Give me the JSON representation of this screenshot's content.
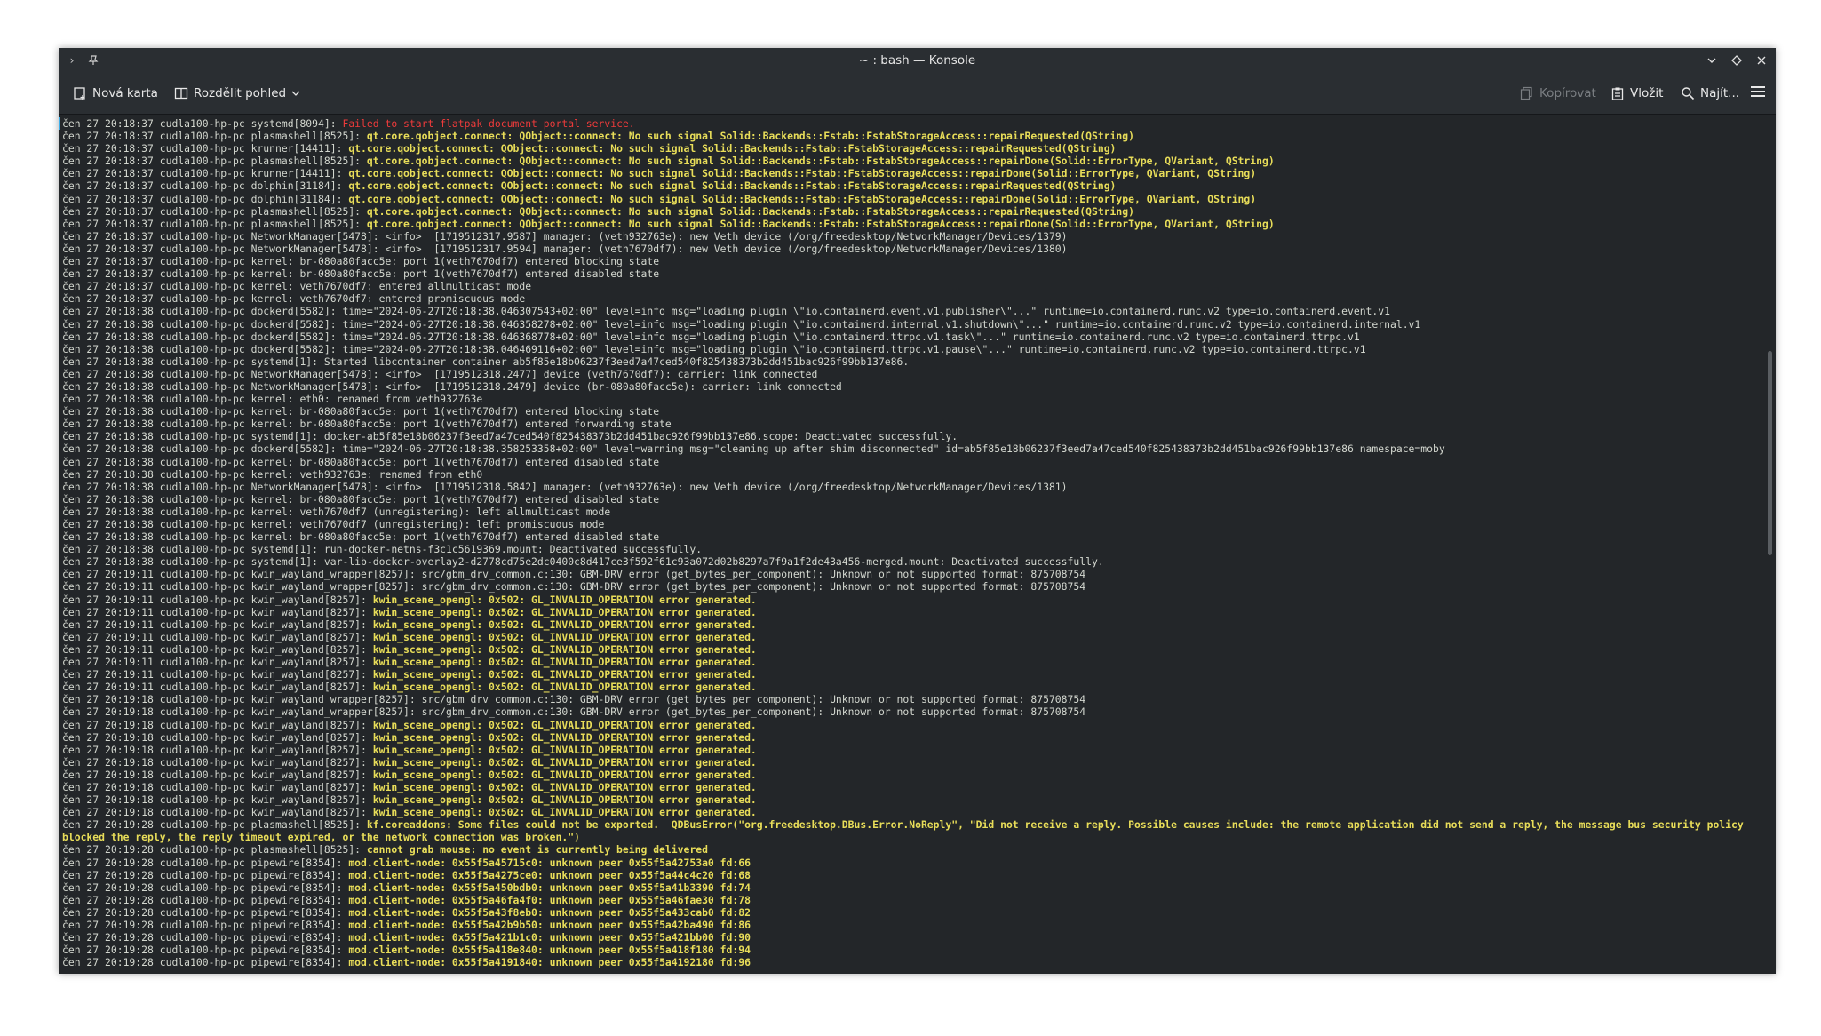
{
  "window": {
    "title": "~ : bash — Konsole"
  },
  "toolbar": {
    "new_tab": "Nová karta",
    "split_view": "Rozdělit pohled",
    "copy": "Kopírovat",
    "paste": "Vložit",
    "find": "Najít..."
  },
  "icons": {
    "expand": "chevron-right-icon",
    "pin": "pin-icon",
    "minimize": "chevron-down-icon",
    "maximize": "diamond-icon",
    "close": "close-icon",
    "new_tab": "new-tab-icon",
    "split": "split-view-icon",
    "copy": "copy-icon",
    "paste": "paste-icon",
    "search": "search-icon",
    "menu": "hamburger-menu-icon"
  },
  "colors": {
    "warning": "#e8dd59",
    "error": "#ef3b3b",
    "normal": "#d3d7cf",
    "background": "#232629"
  },
  "log_lines": [
    {
      "p": "čen 27 20:18:37 cudla100-hp-pc systemd[8094]: ",
      "m": "Failed to start flatpak document portal service.",
      "t": "err"
    },
    {
      "p": "čen 27 20:18:37 cudla100-hp-pc plasmashell[8525]: ",
      "m": "qt.core.qobject.connect: QObject::connect: No such signal Solid::Backends::Fstab::FstabStorageAccess::repairRequested(QString)",
      "t": "warn"
    },
    {
      "p": "čen 27 20:18:37 cudla100-hp-pc krunner[14411]: ",
      "m": "qt.core.qobject.connect: QObject::connect: No such signal Solid::Backends::Fstab::FstabStorageAccess::repairRequested(QString)",
      "t": "warn"
    },
    {
      "p": "čen 27 20:18:37 cudla100-hp-pc plasmashell[8525]: ",
      "m": "qt.core.qobject.connect: QObject::connect: No such signal Solid::Backends::Fstab::FstabStorageAccess::repairDone(Solid::ErrorType, QVariant, QString)",
      "t": "warn"
    },
    {
      "p": "čen 27 20:18:37 cudla100-hp-pc krunner[14411]: ",
      "m": "qt.core.qobject.connect: QObject::connect: No such signal Solid::Backends::Fstab::FstabStorageAccess::repairDone(Solid::ErrorType, QVariant, QString)",
      "t": "warn"
    },
    {
      "p": "čen 27 20:18:37 cudla100-hp-pc dolphin[31184]: ",
      "m": "qt.core.qobject.connect: QObject::connect: No such signal Solid::Backends::Fstab::FstabStorageAccess::repairRequested(QString)",
      "t": "warn"
    },
    {
      "p": "čen 27 20:18:37 cudla100-hp-pc dolphin[31184]: ",
      "m": "qt.core.qobject.connect: QObject::connect: No such signal Solid::Backends::Fstab::FstabStorageAccess::repairDone(Solid::ErrorType, QVariant, QString)",
      "t": "warn"
    },
    {
      "p": "čen 27 20:18:37 cudla100-hp-pc plasmashell[8525]: ",
      "m": "qt.core.qobject.connect: QObject::connect: No such signal Solid::Backends::Fstab::FstabStorageAccess::repairRequested(QString)",
      "t": "warn"
    },
    {
      "p": "čen 27 20:18:37 cudla100-hp-pc plasmashell[8525]: ",
      "m": "qt.core.qobject.connect: QObject::connect: No such signal Solid::Backends::Fstab::FstabStorageAccess::repairDone(Solid::ErrorType, QVariant, QString)",
      "t": "warn"
    },
    {
      "p": "čen 27 20:18:37 cudla100-hp-pc NetworkManager[5478]: <info>  [1719512317.9587] manager: (veth932763e): new Veth device (/org/freedesktop/NetworkManager/Devices/1379)",
      "m": "",
      "t": "n"
    },
    {
      "p": "čen 27 20:18:37 cudla100-hp-pc NetworkManager[5478]: <info>  [1719512317.9594] manager: (veth7670df7): new Veth device (/org/freedesktop/NetworkManager/Devices/1380)",
      "m": "",
      "t": "n"
    },
    {
      "p": "čen 27 20:18:37 cudla100-hp-pc kernel: br-080a80facc5e: port 1(veth7670df7) entered blocking state",
      "m": "",
      "t": "n"
    },
    {
      "p": "čen 27 20:18:37 cudla100-hp-pc kernel: br-080a80facc5e: port 1(veth7670df7) entered disabled state",
      "m": "",
      "t": "n"
    },
    {
      "p": "čen 27 20:18:37 cudla100-hp-pc kernel: veth7670df7: entered allmulticast mode",
      "m": "",
      "t": "n"
    },
    {
      "p": "čen 27 20:18:37 cudla100-hp-pc kernel: veth7670df7: entered promiscuous mode",
      "m": "",
      "t": "n"
    },
    {
      "p": "čen 27 20:18:38 cudla100-hp-pc dockerd[5582]: time=\"2024-06-27T20:18:38.046307543+02:00\" level=info msg=\"loading plugin \\\"io.containerd.event.v1.publisher\\\"...\" runtime=io.containerd.runc.v2 type=io.containerd.event.v1",
      "m": "",
      "t": "n"
    },
    {
      "p": "čen 27 20:18:38 cudla100-hp-pc dockerd[5582]: time=\"2024-06-27T20:18:38.046358278+02:00\" level=info msg=\"loading plugin \\\"io.containerd.internal.v1.shutdown\\\"...\" runtime=io.containerd.runc.v2 type=io.containerd.internal.v1",
      "m": "",
      "t": "n"
    },
    {
      "p": "čen 27 20:18:38 cudla100-hp-pc dockerd[5582]: time=\"2024-06-27T20:18:38.046368778+02:00\" level=info msg=\"loading plugin \\\"io.containerd.ttrpc.v1.task\\\"...\" runtime=io.containerd.runc.v2 type=io.containerd.ttrpc.v1",
      "m": "",
      "t": "n"
    },
    {
      "p": "čen 27 20:18:38 cudla100-hp-pc dockerd[5582]: time=\"2024-06-27T20:18:38.046469116+02:00\" level=info msg=\"loading plugin \\\"io.containerd.ttrpc.v1.pause\\\"...\" runtime=io.containerd.runc.v2 type=io.containerd.ttrpc.v1",
      "m": "",
      "t": "n"
    },
    {
      "p": "čen 27 20:18:38 cudla100-hp-pc systemd[1]: Started libcontainer container ab5f85e18b06237f3eed7a47ced540f825438373b2dd451bac926f99bb137e86.",
      "m": "",
      "t": "n"
    },
    {
      "p": "čen 27 20:18:38 cudla100-hp-pc NetworkManager[5478]: <info>  [1719512318.2477] device (veth7670df7): carrier: link connected",
      "m": "",
      "t": "n"
    },
    {
      "p": "čen 27 20:18:38 cudla100-hp-pc NetworkManager[5478]: <info>  [1719512318.2479] device (br-080a80facc5e): carrier: link connected",
      "m": "",
      "t": "n"
    },
    {
      "p": "čen 27 20:18:38 cudla100-hp-pc kernel: eth0: renamed from veth932763e",
      "m": "",
      "t": "n"
    },
    {
      "p": "čen 27 20:18:38 cudla100-hp-pc kernel: br-080a80facc5e: port 1(veth7670df7) entered blocking state",
      "m": "",
      "t": "n"
    },
    {
      "p": "čen 27 20:18:38 cudla100-hp-pc kernel: br-080a80facc5e: port 1(veth7670df7) entered forwarding state",
      "m": "",
      "t": "n"
    },
    {
      "p": "čen 27 20:18:38 cudla100-hp-pc systemd[1]: docker-ab5f85e18b06237f3eed7a47ced540f825438373b2dd451bac926f99bb137e86.scope: Deactivated successfully.",
      "m": "",
      "t": "n"
    },
    {
      "p": "čen 27 20:18:38 cudla100-hp-pc dockerd[5582]: time=\"2024-06-27T20:18:38.358253358+02:00\" level=warning msg=\"cleaning up after shim disconnected\" id=ab5f85e18b06237f3eed7a47ced540f825438373b2dd451bac926f99bb137e86 namespace=moby",
      "m": "",
      "t": "n"
    },
    {
      "p": "čen 27 20:18:38 cudla100-hp-pc kernel: br-080a80facc5e: port 1(veth7670df7) entered disabled state",
      "m": "",
      "t": "n"
    },
    {
      "p": "čen 27 20:18:38 cudla100-hp-pc kernel: veth932763e: renamed from eth0",
      "m": "",
      "t": "n"
    },
    {
      "p": "čen 27 20:18:38 cudla100-hp-pc NetworkManager[5478]: <info>  [1719512318.5842] manager: (veth932763e): new Veth device (/org/freedesktop/NetworkManager/Devices/1381)",
      "m": "",
      "t": "n"
    },
    {
      "p": "čen 27 20:18:38 cudla100-hp-pc kernel: br-080a80facc5e: port 1(veth7670df7) entered disabled state",
      "m": "",
      "t": "n"
    },
    {
      "p": "čen 27 20:18:38 cudla100-hp-pc kernel: veth7670df7 (unregistering): left allmulticast mode",
      "m": "",
      "t": "n"
    },
    {
      "p": "čen 27 20:18:38 cudla100-hp-pc kernel: veth7670df7 (unregistering): left promiscuous mode",
      "m": "",
      "t": "n"
    },
    {
      "p": "čen 27 20:18:38 cudla100-hp-pc kernel: br-080a80facc5e: port 1(veth7670df7) entered disabled state",
      "m": "",
      "t": "n"
    },
    {
      "p": "čen 27 20:18:38 cudla100-hp-pc systemd[1]: run-docker-netns-f3c1c5619369.mount: Deactivated successfully.",
      "m": "",
      "t": "n"
    },
    {
      "p": "čen 27 20:18:38 cudla100-hp-pc systemd[1]: var-lib-docker-overlay2-d2778cd75e2dc0400c8d417ce3f592f61c93a072d02b8297a7f9a1f2de43a456-merged.mount: Deactivated successfully.",
      "m": "",
      "t": "n"
    },
    {
      "p": "čen 27 20:19:11 cudla100-hp-pc kwin_wayland_wrapper[8257]: src/gbm_drv_common.c:130: GBM-DRV error (get_bytes_per_component): Unknown or not supported format: 875708754",
      "m": "",
      "t": "n"
    },
    {
      "p": "čen 27 20:19:11 cudla100-hp-pc kwin_wayland_wrapper[8257]: src/gbm_drv_common.c:130: GBM-DRV error (get_bytes_per_component): Unknown or not supported format: 875708754",
      "m": "",
      "t": "n"
    },
    {
      "p": "čen 27 20:19:11 cudla100-hp-pc kwin_wayland[8257]: ",
      "m": "kwin_scene_opengl: 0x502: GL_INVALID_OPERATION error generated.",
      "t": "warn"
    },
    {
      "p": "čen 27 20:19:11 cudla100-hp-pc kwin_wayland[8257]: ",
      "m": "kwin_scene_opengl: 0x502: GL_INVALID_OPERATION error generated.",
      "t": "warn"
    },
    {
      "p": "čen 27 20:19:11 cudla100-hp-pc kwin_wayland[8257]: ",
      "m": "kwin_scene_opengl: 0x502: GL_INVALID_OPERATION error generated.",
      "t": "warn"
    },
    {
      "p": "čen 27 20:19:11 cudla100-hp-pc kwin_wayland[8257]: ",
      "m": "kwin_scene_opengl: 0x502: GL_INVALID_OPERATION error generated.",
      "t": "warn"
    },
    {
      "p": "čen 27 20:19:11 cudla100-hp-pc kwin_wayland[8257]: ",
      "m": "kwin_scene_opengl: 0x502: GL_INVALID_OPERATION error generated.",
      "t": "warn"
    },
    {
      "p": "čen 27 20:19:11 cudla100-hp-pc kwin_wayland[8257]: ",
      "m": "kwin_scene_opengl: 0x502: GL_INVALID_OPERATION error generated.",
      "t": "warn"
    },
    {
      "p": "čen 27 20:19:11 cudla100-hp-pc kwin_wayland[8257]: ",
      "m": "kwin_scene_opengl: 0x502: GL_INVALID_OPERATION error generated.",
      "t": "warn"
    },
    {
      "p": "čen 27 20:19:11 cudla100-hp-pc kwin_wayland[8257]: ",
      "m": "kwin_scene_opengl: 0x502: GL_INVALID_OPERATION error generated.",
      "t": "warn"
    },
    {
      "p": "čen 27 20:19:18 cudla100-hp-pc kwin_wayland_wrapper[8257]: src/gbm_drv_common.c:130: GBM-DRV error (get_bytes_per_component): Unknown or not supported format: 875708754",
      "m": "",
      "t": "n"
    },
    {
      "p": "čen 27 20:19:18 cudla100-hp-pc kwin_wayland_wrapper[8257]: src/gbm_drv_common.c:130: GBM-DRV error (get_bytes_per_component): Unknown or not supported format: 875708754",
      "m": "",
      "t": "n"
    },
    {
      "p": "čen 27 20:19:18 cudla100-hp-pc kwin_wayland[8257]: ",
      "m": "kwin_scene_opengl: 0x502: GL_INVALID_OPERATION error generated.",
      "t": "warn"
    },
    {
      "p": "čen 27 20:19:18 cudla100-hp-pc kwin_wayland[8257]: ",
      "m": "kwin_scene_opengl: 0x502: GL_INVALID_OPERATION error generated.",
      "t": "warn"
    },
    {
      "p": "čen 27 20:19:18 cudla100-hp-pc kwin_wayland[8257]: ",
      "m": "kwin_scene_opengl: 0x502: GL_INVALID_OPERATION error generated.",
      "t": "warn"
    },
    {
      "p": "čen 27 20:19:18 cudla100-hp-pc kwin_wayland[8257]: ",
      "m": "kwin_scene_opengl: 0x502: GL_INVALID_OPERATION error generated.",
      "t": "warn"
    },
    {
      "p": "čen 27 20:19:18 cudla100-hp-pc kwin_wayland[8257]: ",
      "m": "kwin_scene_opengl: 0x502: GL_INVALID_OPERATION error generated.",
      "t": "warn"
    },
    {
      "p": "čen 27 20:19:18 cudla100-hp-pc kwin_wayland[8257]: ",
      "m": "kwin_scene_opengl: 0x502: GL_INVALID_OPERATION error generated.",
      "t": "warn"
    },
    {
      "p": "čen 27 20:19:18 cudla100-hp-pc kwin_wayland[8257]: ",
      "m": "kwin_scene_opengl: 0x502: GL_INVALID_OPERATION error generated.",
      "t": "warn"
    },
    {
      "p": "čen 27 20:19:18 cudla100-hp-pc kwin_wayland[8257]: ",
      "m": "kwin_scene_opengl: 0x502: GL_INVALID_OPERATION error generated.",
      "t": "warn"
    },
    {
      "p": "čen 27 20:19:28 cudla100-hp-pc plasmashell[8525]: ",
      "m": "kf.coreaddons: Some files could not be exported.  QDBusError(\"org.freedesktop.DBus.Error.NoReply\", \"Did not receive a reply. Possible causes include: the remote application did not send a reply, the message bus security policy blocked the reply, the reply timeout expired, or the network connection was broken.\")",
      "t": "warn"
    },
    {
      "p": "čen 27 20:19:28 cudla100-hp-pc plasmashell[8525]: ",
      "m": "cannot grab mouse: no event is currently being delivered",
      "t": "warn"
    },
    {
      "p": "čen 27 20:19:28 cudla100-hp-pc pipewire[8354]: ",
      "m": "mod.client-node: 0x55f5a45715c0: unknown peer 0x55f5a42753a0 fd:66",
      "t": "warn"
    },
    {
      "p": "čen 27 20:19:28 cudla100-hp-pc pipewire[8354]: ",
      "m": "mod.client-node: 0x55f5a4275ce0: unknown peer 0x55f5a44c4c20 fd:68",
      "t": "warn"
    },
    {
      "p": "čen 27 20:19:28 cudla100-hp-pc pipewire[8354]: ",
      "m": "mod.client-node: 0x55f5a450bdb0: unknown peer 0x55f5a41b3390 fd:74",
      "t": "warn"
    },
    {
      "p": "čen 27 20:19:28 cudla100-hp-pc pipewire[8354]: ",
      "m": "mod.client-node: 0x55f5a46fa4f0: unknown peer 0x55f5a46fae30 fd:78",
      "t": "warn"
    },
    {
      "p": "čen 27 20:19:28 cudla100-hp-pc pipewire[8354]: ",
      "m": "mod.client-node: 0x55f5a43f8eb0: unknown peer 0x55f5a433cab0 fd:82",
      "t": "warn"
    },
    {
      "p": "čen 27 20:19:28 cudla100-hp-pc pipewire[8354]: ",
      "m": "mod.client-node: 0x55f5a42b9b50: unknown peer 0x55f5a42ba490 fd:86",
      "t": "warn"
    },
    {
      "p": "čen 27 20:19:28 cudla100-hp-pc pipewire[8354]: ",
      "m": "mod.client-node: 0x55f5a421b1c0: unknown peer 0x55f5a421bb00 fd:90",
      "t": "warn"
    },
    {
      "p": "čen 27 20:19:28 cudla100-hp-pc pipewire[8354]: ",
      "m": "mod.client-node: 0x55f5a418e840: unknown peer 0x55f5a418f180 fd:94",
      "t": "warn"
    },
    {
      "p": "čen 27 20:19:28 cudla100-hp-pc pipewire[8354]: ",
      "m": "mod.client-node: 0x55f5a4191840: unknown peer 0x55f5a4192180 fd:96",
      "t": "warn"
    }
  ]
}
